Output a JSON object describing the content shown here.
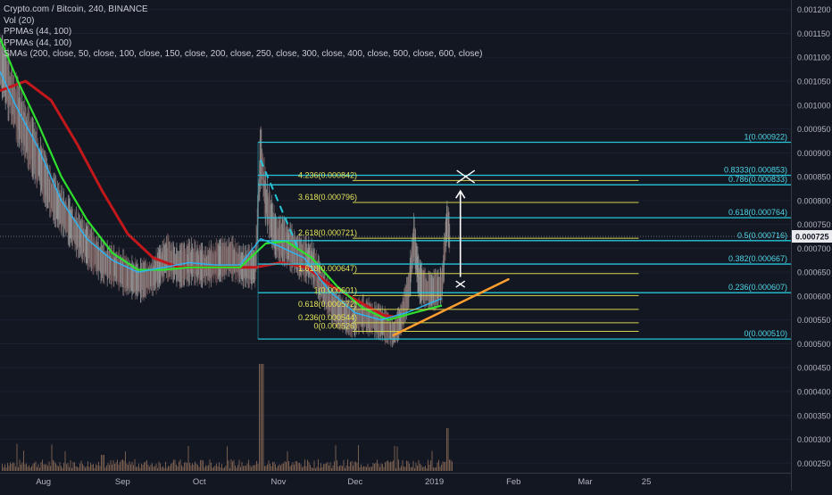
{
  "legend": {
    "title": "Crypto.com / Bitcoin, 240, BINANCE",
    "vol": "Vol (20)",
    "ppma1": "PPMAs (44, 100)",
    "ppma2": "PPMAs (44, 100)",
    "smas": "SMAs (200, close, 50, close, 100, close, 150, close, 200, close, 250, close, 300, close, 400, close, 500, close, 600, close)"
  },
  "colors": {
    "background": "#131722",
    "fib_cyan": "#26c6da",
    "fib_yellow": "#d4d44e",
    "fib_text_cyan": "#4fd6e6",
    "fib_text_yellow": "#e6e65c",
    "ma_red": "#c2181b",
    "ma_green": "#2ee02e",
    "ma_cyan": "#29b6f6",
    "trend_orange": "#ff9f2e",
    "annotation_white": "#ffffff",
    "volume": "#8a6a56",
    "axis_text": "#b2b5be",
    "price_tag_bg": "#e9eaed"
  },
  "chart_data": {
    "type": "line",
    "title": "Crypto.com / Bitcoin, 240, BINANCE",
    "y_range": [
      0.00023,
      0.00122
    ],
    "y_ticks": [
      "0.001200",
      "0.001150",
      "0.001100",
      "0.001050",
      "0.001000",
      "0.000950",
      "0.000900",
      "0.000850",
      "0.000800",
      "0.000750",
      "0.000700",
      "0.000650",
      "0.000600",
      "0.000550",
      "0.000500",
      "0.000450",
      "0.000400",
      "0.000350",
      "0.000300",
      "0.000250"
    ],
    "y_tick_values": [
      0.0012,
      0.00115,
      0.0011,
      0.00105,
      0.001,
      0.00095,
      0.0009,
      0.00085,
      0.0008,
      0.00075,
      0.0007,
      0.00065,
      0.0006,
      0.00055,
      0.0005,
      0.00045,
      0.0004,
      0.00035,
      0.0003,
      0.00025
    ],
    "x_range": [
      "2018-07-15",
      "2019-03-22"
    ],
    "x_ticks": [
      {
        "label": "Aug",
        "date": "2018-08-01"
      },
      {
        "label": "Sep",
        "date": "2018-09-01"
      },
      {
        "label": "Oct",
        "date": "2018-10-01"
      },
      {
        "label": "Nov",
        "date": "2018-11-01"
      },
      {
        "label": "Dec",
        "date": "2018-12-01"
      },
      {
        "label": "2019",
        "date": "2019-01-01"
      },
      {
        "label": "Feb",
        "date": "2019-02-01"
      },
      {
        "label": "Mar",
        "date": "2019-03-01"
      },
      {
        "label": "25",
        "date": "2019-03-25"
      }
    ],
    "current_price": {
      "value": 0.000725,
      "label": "0.000725"
    },
    "series": [
      {
        "name": "price",
        "values": [
          [
            "2018-07-15",
            0.00109
          ],
          [
            "2018-07-20",
            0.00101
          ],
          [
            "2018-07-25",
            0.00094
          ],
          [
            "2018-07-30",
            0.00088
          ],
          [
            "2018-08-04",
            0.00081
          ],
          [
            "2018-08-09",
            0.00077
          ],
          [
            "2018-08-14",
            0.00073
          ],
          [
            "2018-08-19",
            0.0007
          ],
          [
            "2018-08-24",
            0.00067
          ],
          [
            "2018-08-29",
            0.00066
          ],
          [
            "2018-09-03",
            0.00064
          ],
          [
            "2018-09-08",
            0.00063
          ],
          [
            "2018-09-13",
            0.00064
          ],
          [
            "2018-09-18",
            0.00068
          ],
          [
            "2018-09-23",
            0.00066
          ],
          [
            "2018-09-28",
            0.00067
          ],
          [
            "2018-10-03",
            0.00066
          ],
          [
            "2018-10-08",
            0.00067
          ],
          [
            "2018-10-13",
            0.00068
          ],
          [
            "2018-10-18",
            0.00066
          ],
          [
            "2018-10-23",
            0.00066
          ],
          [
            "2018-10-25",
            0.0009
          ],
          [
            "2018-10-27",
            0.0008
          ],
          [
            "2018-10-31",
            0.00072
          ],
          [
            "2018-11-04",
            0.00071
          ],
          [
            "2018-11-09",
            0.00068
          ],
          [
            "2018-11-14",
            0.00067
          ],
          [
            "2018-11-18",
            0.00062
          ],
          [
            "2018-11-22",
            0.00058
          ],
          [
            "2018-11-26",
            0.00056
          ],
          [
            "2018-11-30",
            0.00055
          ],
          [
            "2018-12-04",
            0.00056
          ],
          [
            "2018-12-08",
            0.00055
          ],
          [
            "2018-12-12",
            0.00054
          ],
          [
            "2018-12-16",
            0.00052
          ],
          [
            "2018-12-19",
            0.00055
          ],
          [
            "2018-12-22",
            0.00061
          ],
          [
            "2018-12-24",
            0.00072
          ],
          [
            "2018-12-26",
            0.00063
          ],
          [
            "2018-12-29",
            0.00061
          ],
          [
            "2019-01-01",
            0.00061
          ],
          [
            "2019-01-04",
            0.00062
          ],
          [
            "2019-01-06",
            0.00076
          ],
          [
            "2019-01-07",
            0.000725
          ]
        ]
      },
      {
        "name": "ma-red",
        "values": [
          [
            "2018-07-15",
            0.00103
          ],
          [
            "2018-07-25",
            0.00105
          ],
          [
            "2018-08-04",
            0.00101
          ],
          [
            "2018-08-14",
            0.00092
          ],
          [
            "2018-08-24",
            0.00082
          ],
          [
            "2018-09-03",
            0.00073
          ],
          [
            "2018-09-13",
            0.00068
          ],
          [
            "2018-09-23",
            0.00066
          ],
          [
            "2018-10-03",
            0.00066
          ],
          [
            "2018-10-13",
            0.00066
          ],
          [
            "2018-10-23",
            0.00066
          ],
          [
            "2018-11-02",
            0.00067
          ],
          [
            "2018-11-12",
            0.00066
          ],
          [
            "2018-11-22",
            0.00062
          ],
          [
            "2018-12-02",
            0.00059
          ],
          [
            "2018-12-12",
            0.00056
          ],
          [
            "2018-12-18",
            0.000555
          ]
        ]
      },
      {
        "name": "ma-green",
        "values": [
          [
            "2018-07-15",
            0.00114
          ],
          [
            "2018-07-22",
            0.00105
          ],
          [
            "2018-07-30",
            0.00096
          ],
          [
            "2018-08-08",
            0.00085
          ],
          [
            "2018-08-18",
            0.00076
          ],
          [
            "2018-08-28",
            0.00069
          ],
          [
            "2018-09-07",
            0.000655
          ],
          [
            "2018-09-17",
            0.000655
          ],
          [
            "2018-09-27",
            0.00066
          ],
          [
            "2018-10-07",
            0.00066
          ],
          [
            "2018-10-17",
            0.00066
          ],
          [
            "2018-10-27",
            0.00071
          ],
          [
            "2018-11-04",
            0.000715
          ],
          [
            "2018-11-14",
            0.00068
          ],
          [
            "2018-11-24",
            0.00062
          ],
          [
            "2018-12-04",
            0.000575
          ],
          [
            "2018-12-14",
            0.00055
          ],
          [
            "2018-12-24",
            0.000565
          ],
          [
            "2019-01-04",
            0.00058
          ]
        ]
      },
      {
        "name": "ma-cyan",
        "values": [
          [
            "2018-07-15",
            0.00107
          ],
          [
            "2018-07-22",
            0.00099
          ],
          [
            "2018-07-30",
            0.00091
          ],
          [
            "2018-08-08",
            0.0008
          ],
          [
            "2018-08-18",
            0.00072
          ],
          [
            "2018-08-28",
            0.000675
          ],
          [
            "2018-09-07",
            0.00065
          ],
          [
            "2018-09-17",
            0.00066
          ],
          [
            "2018-09-27",
            0.00067
          ],
          [
            "2018-10-07",
            0.000665
          ],
          [
            "2018-10-17",
            0.000665
          ],
          [
            "2018-10-25",
            0.00072
          ],
          [
            "2018-11-01",
            0.000705
          ],
          [
            "2018-11-11",
            0.00068
          ],
          [
            "2018-11-21",
            0.00061
          ],
          [
            "2018-12-01",
            0.000565
          ],
          [
            "2018-12-11",
            0.00055
          ],
          [
            "2018-12-21",
            0.000565
          ],
          [
            "2019-01-04",
            0.000595
          ]
        ]
      }
    ],
    "fib_right": [
      {
        "label": "1(0.000922)",
        "value": 0.000922
      },
      {
        "label": "0.8333(0.000853)",
        "value": 0.000853
      },
      {
        "label": "0.786(0.000833)",
        "value": 0.000833
      },
      {
        "label": "0.618(0.000764)",
        "value": 0.000764
      },
      {
        "label": "0.5(0.000716)",
        "value": 0.000716
      },
      {
        "label": "0.382(0.000667)",
        "value": 0.000667
      },
      {
        "label": "0.236(0.000607)",
        "value": 0.000607
      },
      {
        "label": "0(0.000510)",
        "value": 0.00051
      }
    ],
    "fib_right_start": "2018-10-24",
    "fib_ext": [
      {
        "label": "4.236(0.000842)",
        "value": 0.000842
      },
      {
        "label": "3.618(0.000796)",
        "value": 0.000796
      },
      {
        "label": "2.618(0.000721)",
        "value": 0.000721
      },
      {
        "label": "1.618(0.000647)",
        "value": 0.000647
      },
      {
        "label": "1(0.000601)",
        "value": 0.000601
      },
      {
        "label": "0.618(0.000572)",
        "value": 0.000572
      },
      {
        "label": "0.236(0.000544)",
        "value": 0.000544
      },
      {
        "label": "0(0.000526)",
        "value": 0.000526
      }
    ],
    "fib_ext_range": [
      "2018-11-30",
      "2019-03-22"
    ],
    "trendline": [
      [
        "2018-12-16",
        0.000518
      ],
      [
        "2019-01-30",
        0.000635
      ]
    ],
    "dashed_line": [
      [
        "2018-10-25",
        0.000885
      ],
      [
        "2018-11-09",
        0.000695
      ]
    ],
    "annotation_arrow": {
      "date": "2019-01-07",
      "from": 0.00064,
      "to": 0.00082
    },
    "volume": [],
    "volume_label": "Vol (20)"
  }
}
